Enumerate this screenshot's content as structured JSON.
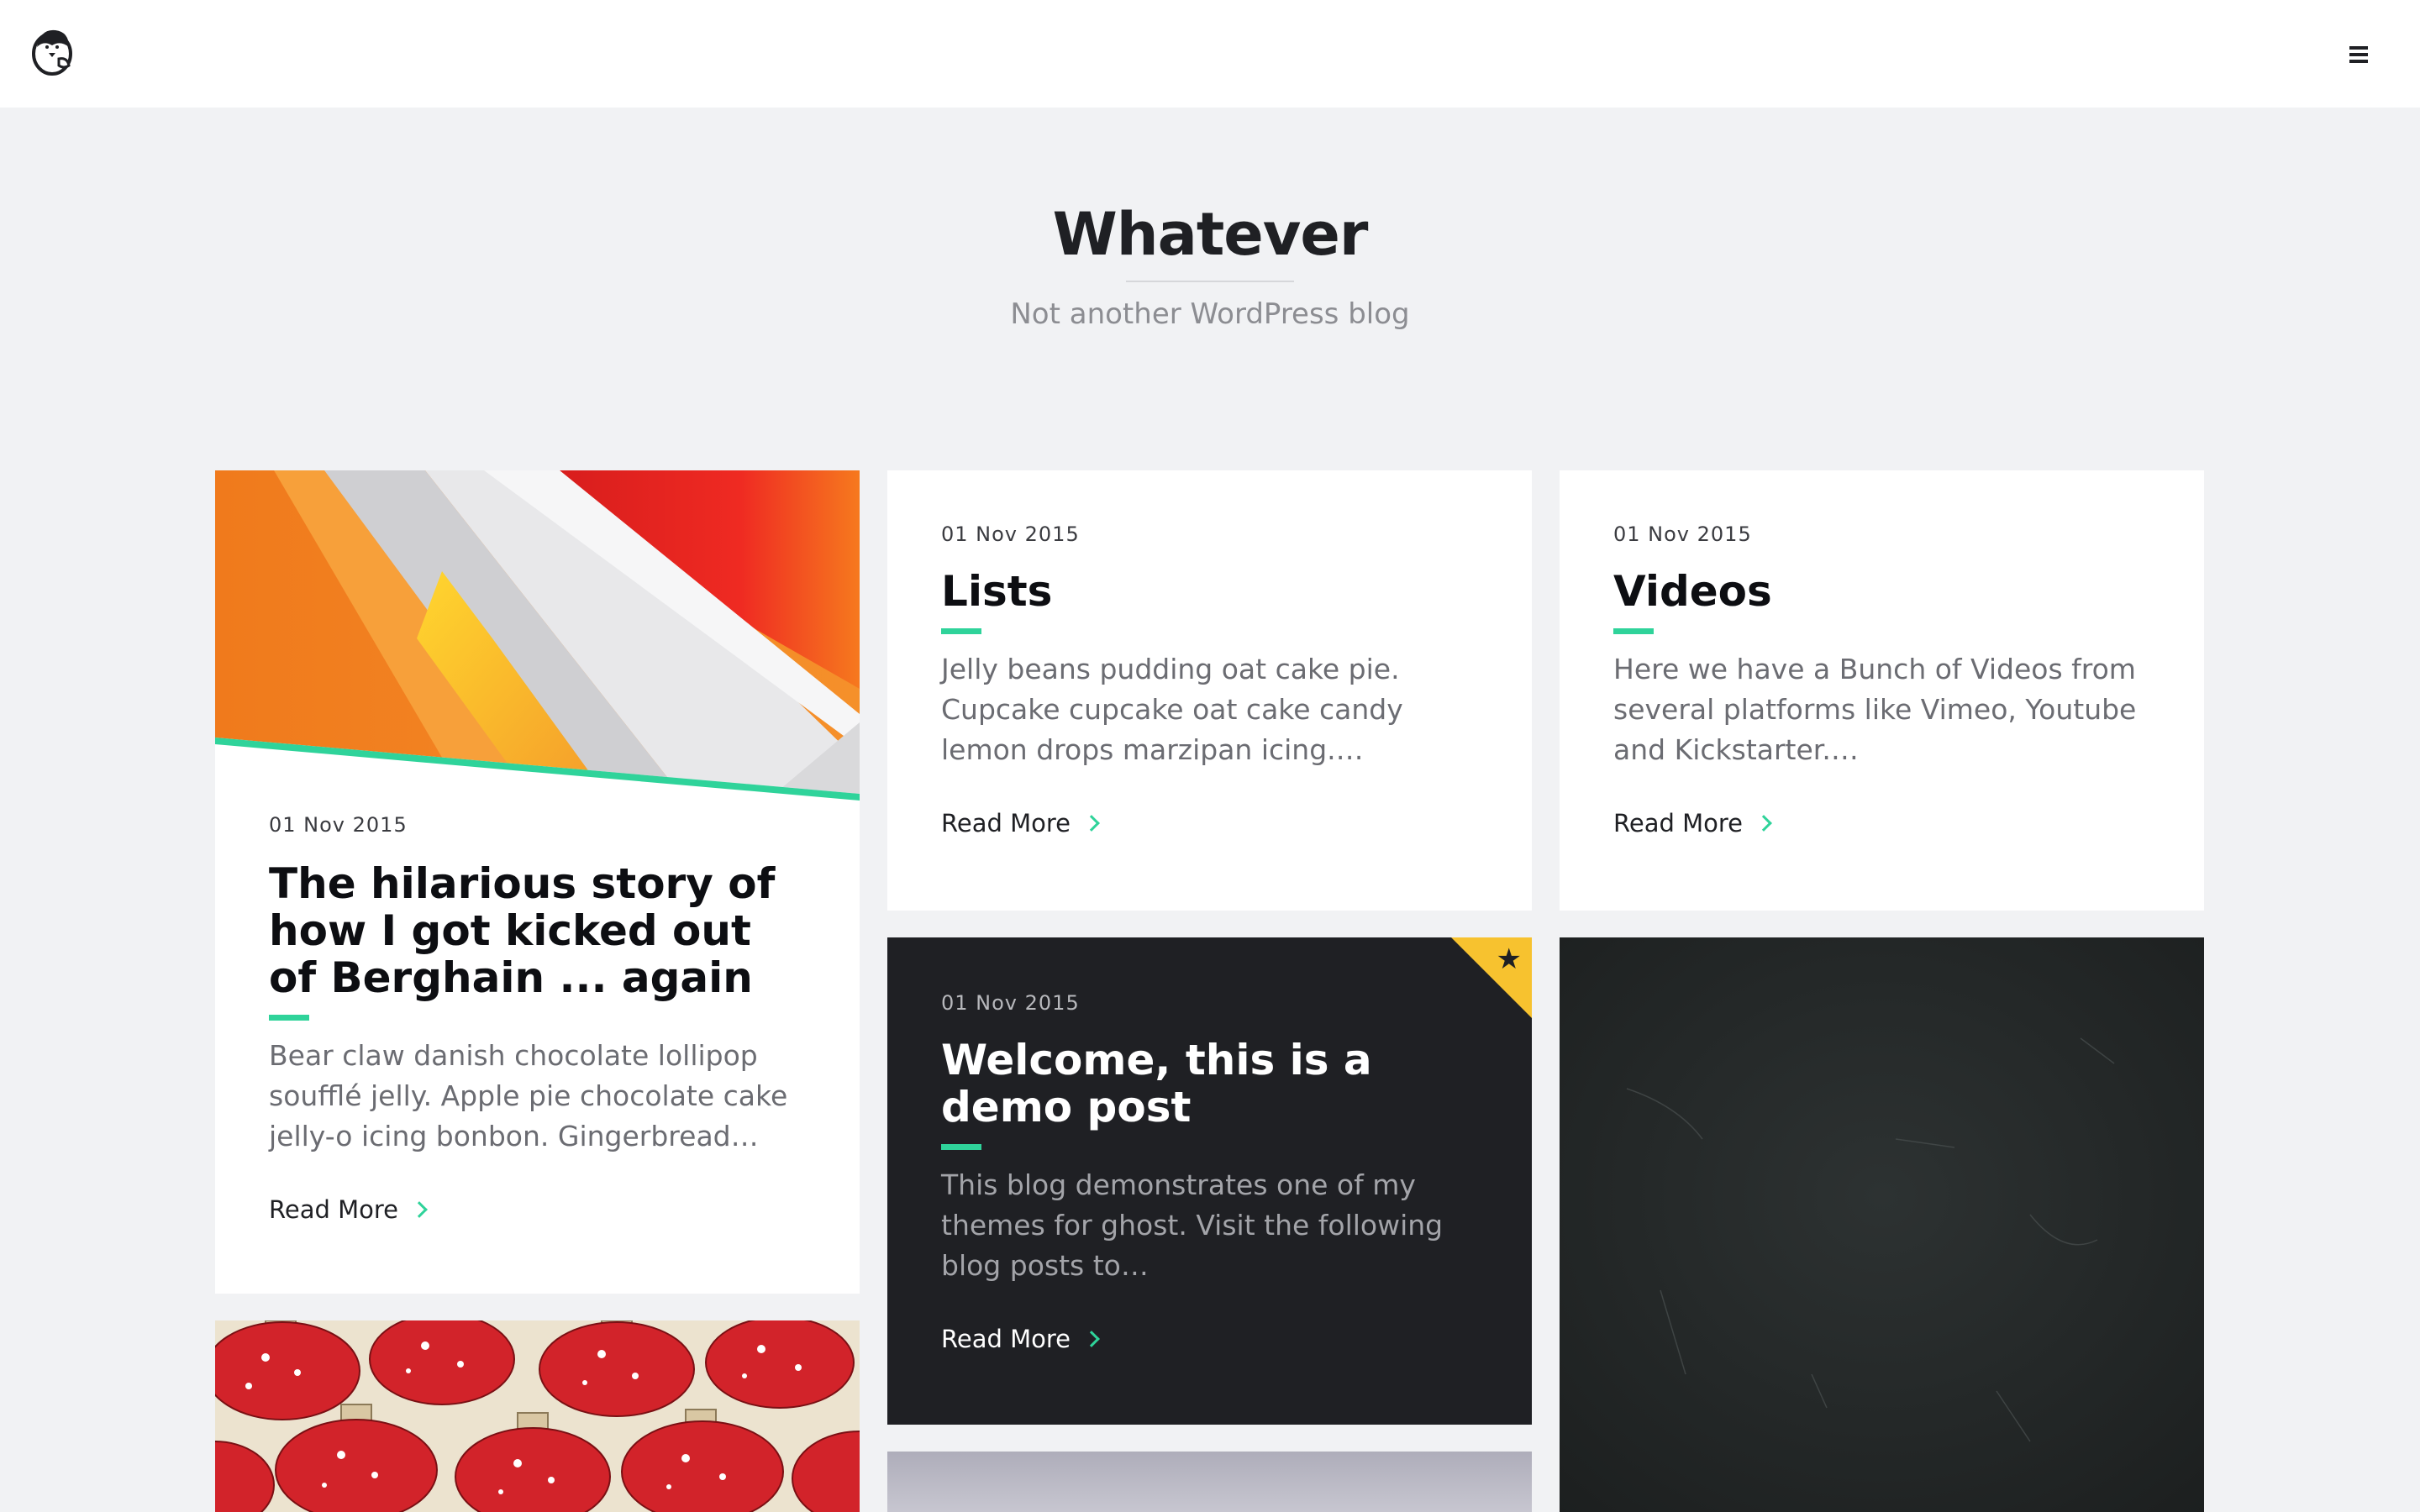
{
  "header": {
    "logo_icon": "penguin-logo-icon",
    "menu_icon": "hamburger-menu-icon"
  },
  "hero": {
    "title": "Whatever",
    "description": "Not another WordPress blog"
  },
  "posts": [
    {
      "date": "01 Nov 2015",
      "title": "The hilarious story of how I got kicked out of Berghain ... again",
      "excerpt": "Bear claw danish chocolate lollipop soufflé jelly. Apple pie chocolate cake jelly-o icing bonbon. Gingerbread…",
      "read_more": "Read More",
      "cover_image": "abstract-orange-red-stripes-image"
    },
    {
      "date": "01 Nov 2015",
      "title": "Lists",
      "excerpt": "Jelly beans pudding oat cake pie. Cupcake cupcake oat cake candy lemon drops marzipan icing.…",
      "read_more": "Read More"
    },
    {
      "date": "01 Nov 2015",
      "title": "Videos",
      "excerpt": "Here we have a Bunch of Videos from several platforms like Vimeo, Youtube and Kickstarter.…",
      "read_more": "Read More"
    },
    {
      "date": "01 Nov 2015",
      "title": "Welcome, this is a demo post",
      "excerpt": "This blog demonstrates one of my themes for ghost. Visit the following blog posts to…",
      "read_more": "Read More",
      "featured_icon": "star-icon"
    }
  ],
  "colors": {
    "accent": "#2fd39a",
    "featured": "#f7c22f",
    "dark_card": "#1f2024",
    "background": "#f1f2f4"
  }
}
